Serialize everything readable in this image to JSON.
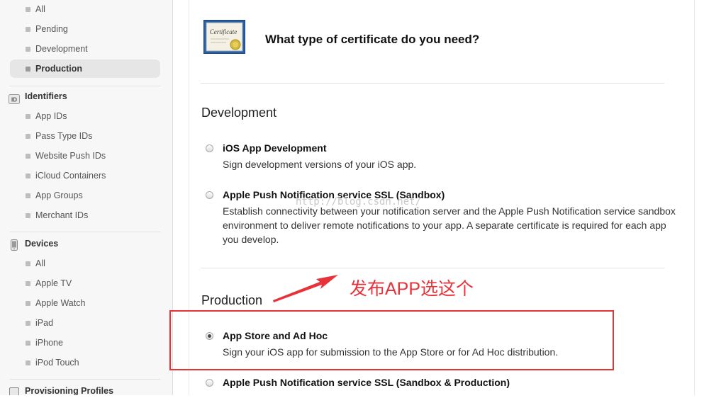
{
  "sidebar": {
    "cert_items": [
      {
        "label": "All"
      },
      {
        "label": "Pending"
      },
      {
        "label": "Development"
      },
      {
        "label": "Production",
        "active": true
      }
    ],
    "identifiers": {
      "title": "Identifiers",
      "icon": "id-icon",
      "items": [
        {
          "label": "App IDs"
        },
        {
          "label": "Pass Type IDs"
        },
        {
          "label": "Website Push IDs"
        },
        {
          "label": "iCloud Containers"
        },
        {
          "label": "App Groups"
        },
        {
          "label": "Merchant IDs"
        }
      ]
    },
    "devices": {
      "title": "Devices",
      "icon": "phone-icon",
      "items": [
        {
          "label": "All"
        },
        {
          "label": "Apple TV"
        },
        {
          "label": "Apple Watch"
        },
        {
          "label": "iPad"
        },
        {
          "label": "iPhone"
        },
        {
          "label": "iPod Touch"
        }
      ]
    },
    "provisioning": {
      "title": "Provisioning Profiles",
      "icon": "profile-icon"
    }
  },
  "main": {
    "icon": "certificate-icon",
    "icon_text": "Certificate",
    "title": "What type of certificate do you need?",
    "development": {
      "title": "Development",
      "options": [
        {
          "title": "iOS App Development",
          "desc": "Sign development versions of your iOS app.",
          "selected": false
        },
        {
          "title": "Apple Push Notification service SSL (Sandbox)",
          "desc": "Establish connectivity between your notification server and the Apple Push Notification service sandbox environment to deliver remote notifications to your app. A separate certificate is required for each app you develop.",
          "selected": false
        }
      ]
    },
    "production": {
      "title": "Production",
      "options": [
        {
          "title": "App Store and Ad Hoc",
          "desc": "Sign your iOS app for submission to the App Store or for Ad Hoc distribution.",
          "selected": true
        },
        {
          "title": "Apple Push Notification service SSL (Sandbox & Production)",
          "desc": "",
          "selected": false
        }
      ]
    },
    "watermark": "http://blog.csdn.net/"
  },
  "annotation": {
    "text": "发布APP选这个",
    "color": "#e8323a"
  }
}
